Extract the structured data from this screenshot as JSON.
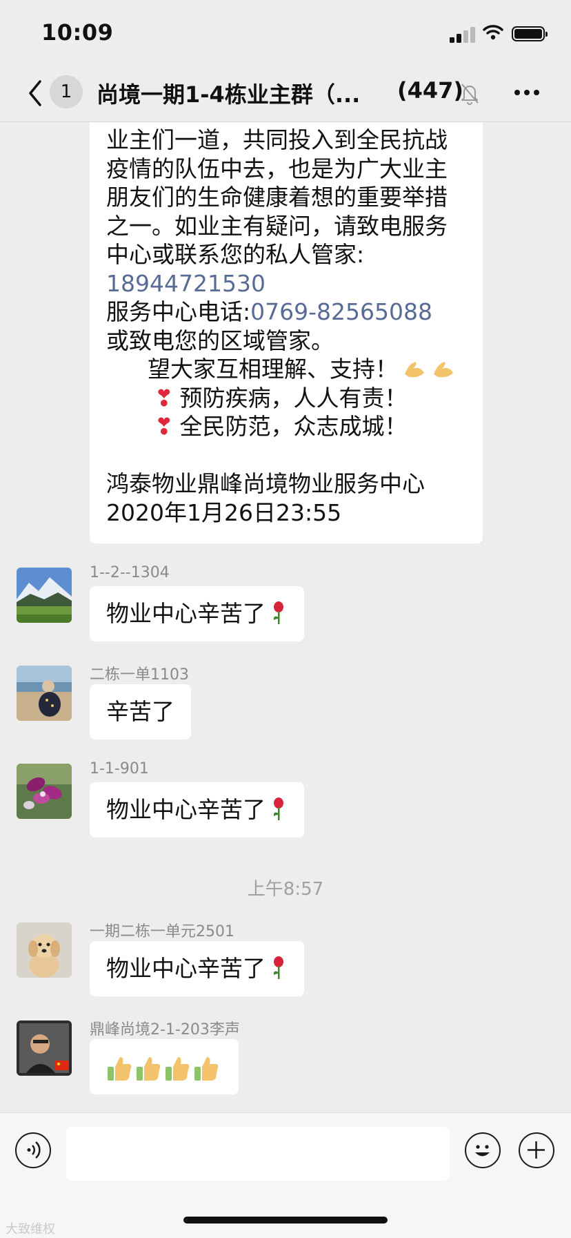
{
  "status_bar": {
    "time": "10:09"
  },
  "nav": {
    "unread_badge": "1",
    "title": "尚境一期1-4栋业主群（...",
    "member_count": "(447)"
  },
  "announcement": {
    "lines": [
      "业主们一道，共同投入到全民抗战",
      "疫情的队伍中去，也是为广大业主",
      "朋友们的生命健康着想的重要举措",
      "之一。如业主有疑问，请致电服务",
      "中心或联系您的私人管家:"
    ],
    "phone_private": "18944721530",
    "service_label": "服务中心电话:",
    "phone_service": "0769-82565088",
    "after_phone": "或致电您的区域管家。",
    "slogan1": "望大家互相理解、支持！",
    "slogan2": "预防疾病，人人有责！",
    "slogan3": "全民防范，众志成城！",
    "signature": "鸿泰物业鼎峰尚境物业服务中心",
    "date": "2020年1月26日23:55"
  },
  "messages": [
    {
      "sender": "1--2--1304",
      "text": "物业中心辛苦了",
      "emoji": "rose"
    },
    {
      "sender": "二栋一单1103",
      "text": "辛苦了"
    },
    {
      "sender": "1-1-901",
      "text": "物业中心辛苦了",
      "emoji": "rose"
    },
    {
      "sender": "一期二栋一单元2501",
      "text": "物业中心辛苦了",
      "emoji": "rose"
    },
    {
      "sender": "鼎峰尚境2-1-203李声",
      "emoji": "thumbs-up x4"
    }
  ],
  "timestamp": "上午8:57",
  "watermark": "大致维权",
  "colors": {
    "link": "#576b95",
    "background": "#ededed",
    "bubble": "#ffffff"
  }
}
